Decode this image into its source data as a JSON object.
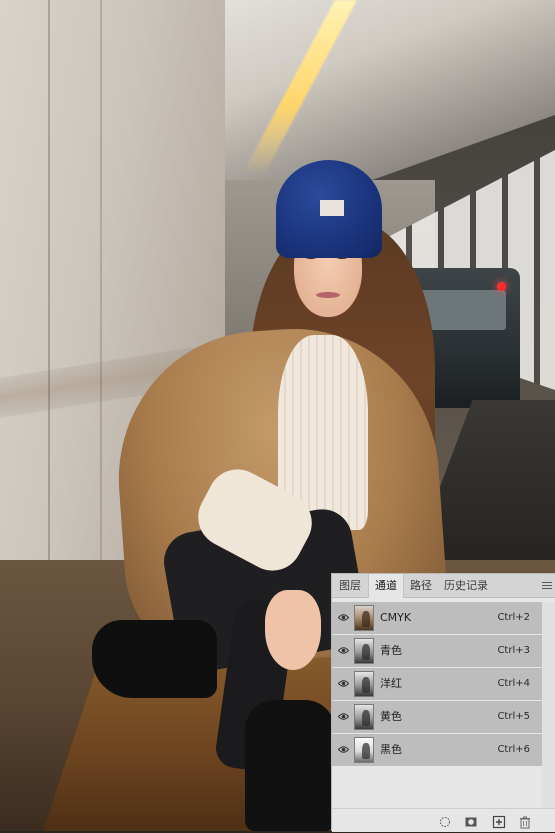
{
  "panel": {
    "tabs": [
      {
        "label": "图层",
        "active": false
      },
      {
        "label": "通道",
        "active": true
      },
      {
        "label": "路径",
        "active": false
      },
      {
        "label": "历史记录",
        "active": false
      }
    ],
    "menu_icon": "panel-menu-icon",
    "channels": [
      {
        "name": "CMYK",
        "shortcut": "Ctrl+2",
        "visible": true,
        "composite": true
      },
      {
        "name": "青色",
        "shortcut": "Ctrl+3",
        "visible": true,
        "composite": false
      },
      {
        "name": "洋红",
        "shortcut": "Ctrl+4",
        "visible": true,
        "composite": false
      },
      {
        "name": "黄色",
        "shortcut": "Ctrl+5",
        "visible": true,
        "composite": false
      },
      {
        "name": "黑色",
        "shortcut": "Ctrl+6",
        "visible": true,
        "composite": false
      }
    ],
    "footer_icons": [
      "load-selection-icon",
      "save-selection-icon",
      "new-channel-icon",
      "delete-channel-icon"
    ]
  },
  "colors": {
    "panel_bg": "#e6e6e6",
    "row_bg": "#bdbdbd",
    "tab_bar": "#d4d4d4"
  }
}
